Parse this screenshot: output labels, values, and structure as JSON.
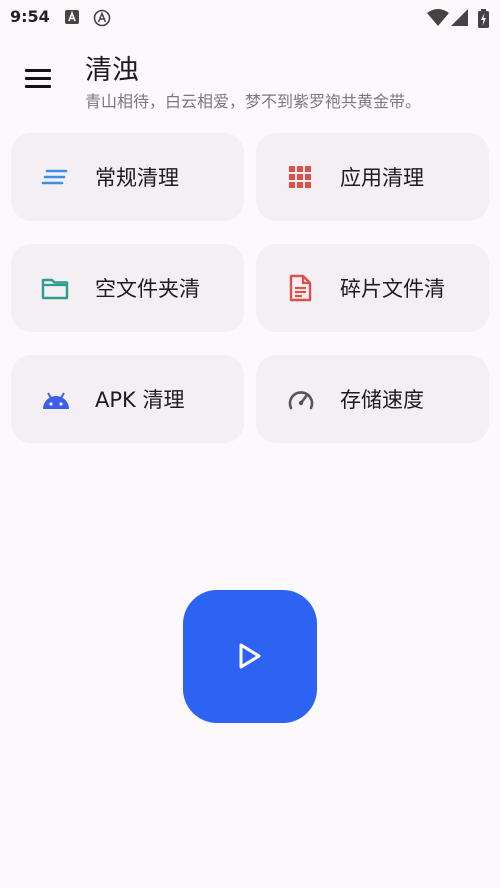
{
  "status": {
    "time": "9:54",
    "icons": [
      "notification-a-icon",
      "notification-circle-icon",
      "wifi-icon",
      "signal-icon",
      "battery-charging-icon"
    ]
  },
  "header": {
    "title": "清浊",
    "subtitle": "青山相待，白云相爱，梦不到紫罗袍共黄金带。"
  },
  "actions": [
    {
      "label": "常规清理",
      "icon": "lines-icon",
      "color": "#3d8ee6"
    },
    {
      "label": "应用清理",
      "icon": "grid-icon",
      "color": "#e0504a"
    },
    {
      "label": "空文件夹清",
      "icon": "folder-icon",
      "color": "#2f9c8e"
    },
    {
      "label": "碎片文件清",
      "icon": "document-icon",
      "color": "#e0504a"
    },
    {
      "label": "APK 清理",
      "icon": "android-icon",
      "color": "#3c5ee8"
    },
    {
      "label": "存储速度",
      "icon": "speedometer-icon",
      "color": "#555555"
    }
  ],
  "fab": {
    "icon": "play-icon",
    "color": "#2d63f2"
  }
}
